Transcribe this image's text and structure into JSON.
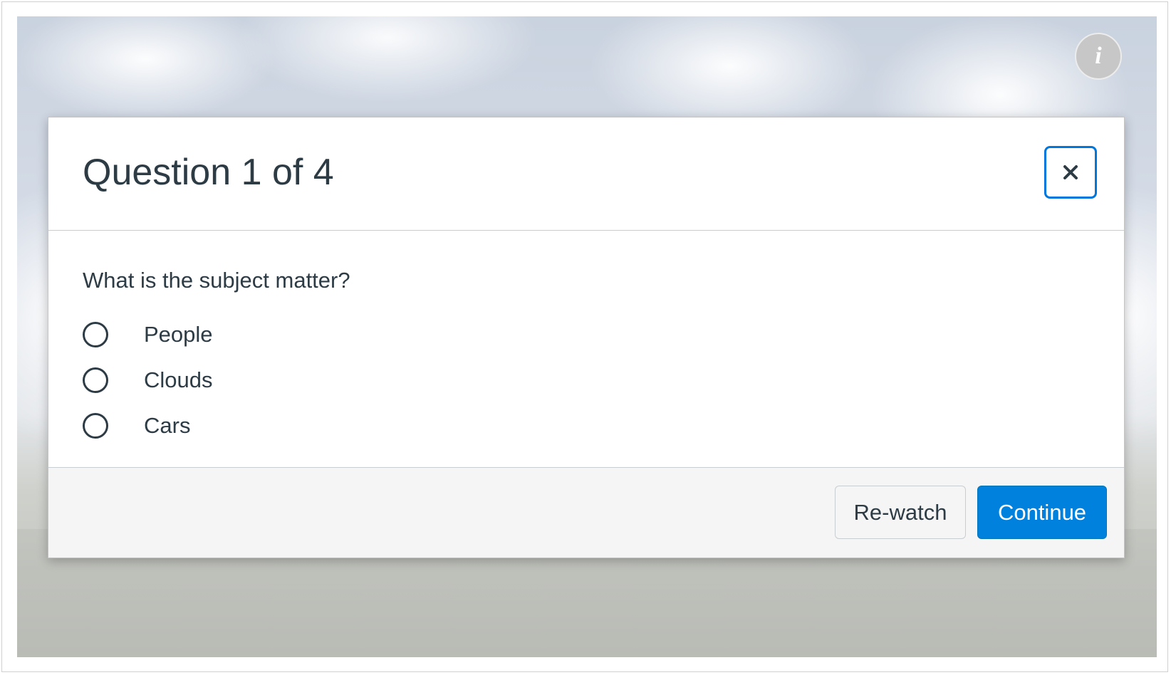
{
  "info_button": {
    "label": "i",
    "icon": "info-icon"
  },
  "modal": {
    "title": "Question 1 of 4",
    "close": {
      "icon": "close-icon",
      "accent_color": "#0077dd"
    },
    "question": "What is the subject matter?",
    "options": [
      {
        "label": "People",
        "selected": false
      },
      {
        "label": "Clouds",
        "selected": false
      },
      {
        "label": "Cars",
        "selected": false
      }
    ],
    "footer": {
      "rewatch_label": "Re-watch",
      "continue_label": "Continue",
      "continue_color": "#0081dd"
    }
  }
}
